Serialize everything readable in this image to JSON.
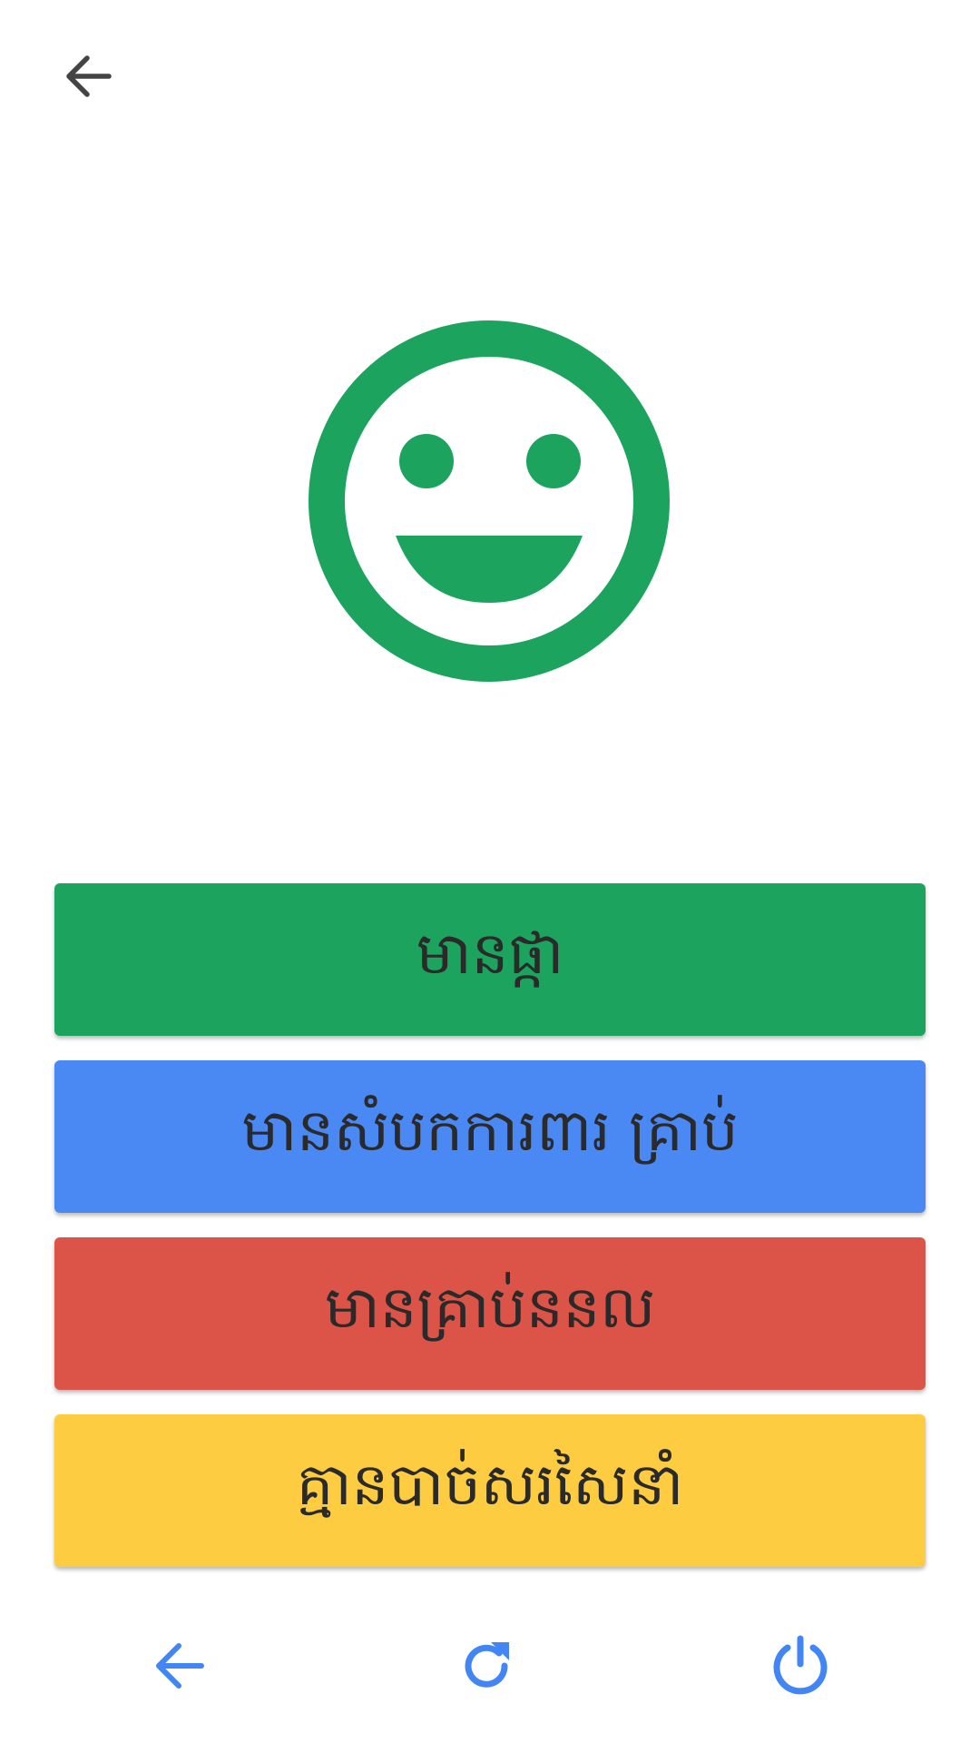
{
  "colors": {
    "accent_green": "#1ca45f",
    "accent_blue": "#4a89f3",
    "accent_red": "#dc5347",
    "accent_yellow": "#fdcc41",
    "nav_blue": "#4285f4",
    "icon_dark": "#444444"
  },
  "header": {
    "back_icon": "arrow-left-icon"
  },
  "feedback": {
    "icon": "smiley-face-icon"
  },
  "choices": [
    {
      "label": "មានផ្កា",
      "color": "#1ca45f"
    },
    {
      "label": "មានសំបកការពារ គ្រាប់",
      "color": "#4a89f3"
    },
    {
      "label": "មានគ្រាប់ននល",
      "color": "#dc5347"
    },
    {
      "label": "គ្មានបាច់សរសៃនាំ",
      "color": "#fdcc41"
    }
  ],
  "bottom_nav": {
    "back_icon": "arrow-left-icon",
    "refresh_icon": "refresh-icon",
    "power_icon": "power-icon"
  }
}
